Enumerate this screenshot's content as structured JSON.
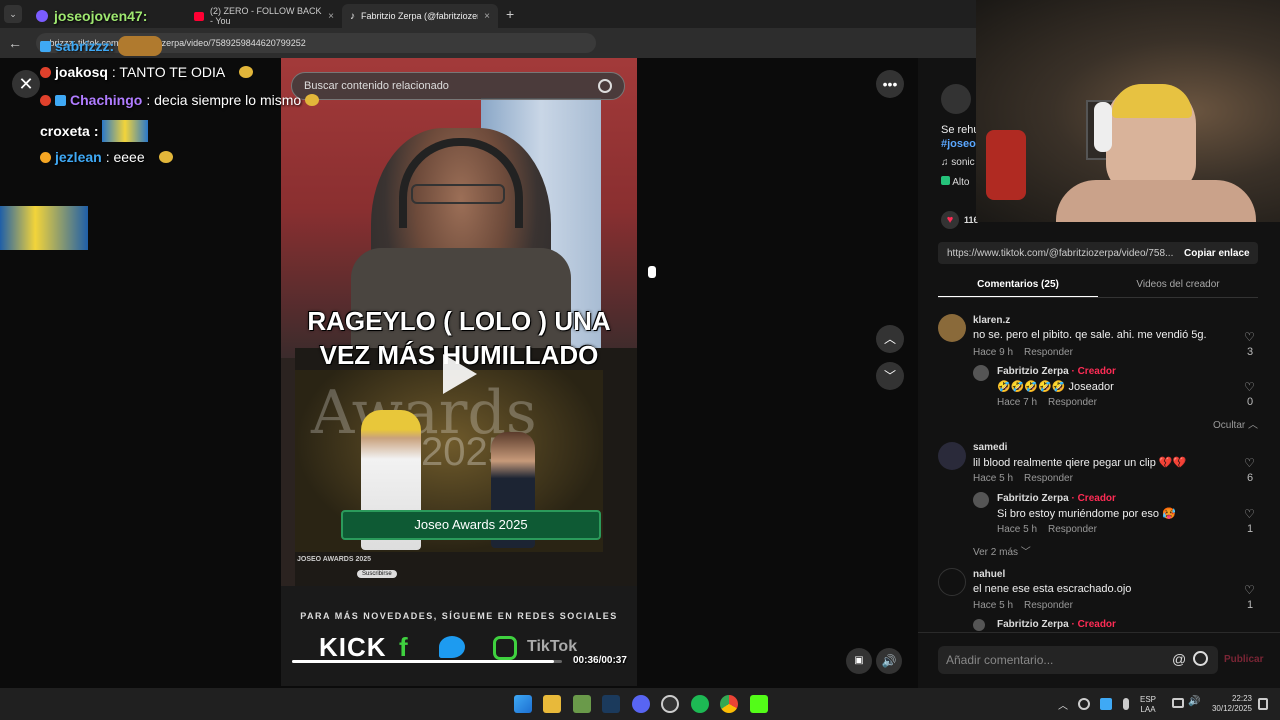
{
  "browser": {
    "tabs": [
      {
        "label": "joseojoven47:",
        "close": "×"
      },
      {
        "label": "(2) ZERO - FOLLOW BACK - You",
        "close": "×"
      },
      {
        "label": "Fabritzio Zerpa (@fabritziozerp",
        "close": "×"
      }
    ],
    "new_tab": "+",
    "url": "sabrizzz: tiktok.com/@fabritziozerpa/video/7589259844620799252"
  },
  "chat": {
    "header_user": "joseojoven47:",
    "header_user2": "sabrizzz:",
    "lines": [
      {
        "user": "joakosq",
        "text": ": TANTO TE ODIA",
        "color": "#ffffff",
        "badge": "#e0412c"
      },
      {
        "user": "Chachingo",
        "text": ": decia siempre lo mismo",
        "color": "#b07cff",
        "badge": "#e0412c"
      },
      {
        "user": "croxeta",
        "text": ":",
        "color": "#ffffff",
        "badge": ""
      },
      {
        "user": "jezlean",
        "text": ": eeee",
        "color": "#3fa9f5",
        "badge": "#f5a623"
      }
    ]
  },
  "video": {
    "search_placeholder": "Buscar contenido relacionado",
    "caption_line1": "RAGEYLO ( LOLO ) UNA",
    "caption_line2": "VEZ MÁS HUMILLADO",
    "inner_title": "JOSEO AWARDS 2025",
    "banner": "Joseo Awards 2025",
    "awards_big": "Awards",
    "awards_year": "2025",
    "subscribe": "Suscribirse",
    "social_text": "PARA MÁS NOVEDADES, SÍGUEME EN REDES SOCIALES",
    "kick": "KICK",
    "tiktok": "TikTok",
    "time": "00:36/00:37",
    "progress": 0.97
  },
  "panel": {
    "desc_1": "Se rehu",
    "desc_2": "#joseo",
    "sound": "sonic",
    "quality": "Alto",
    "likes": "116",
    "share_url": "https://www.tiktok.com/@fabritziozerpa/video/758...",
    "copy_link": "Copiar enlace",
    "tab_comments": "Comentarios (25)",
    "tab_creator": "Videos del creador",
    "comments": [
      {
        "user": "klaren.z",
        "text": "no se. pero el pibito. qe sale. ahi. me vendió 5g.",
        "time": "Hace 9 h",
        "reply": "Responder",
        "likes": "3"
      },
      {
        "user": "Fabritzio Zerpa",
        "creator": "· Creador",
        "text": "🤣🤣🤣🤣🤣 Joseador",
        "time": "Hace 7 h",
        "reply": "Responder",
        "likes": "0"
      },
      {
        "user": "samedi",
        "text": "lil blood realmente qiere pegar un clip 💔💔",
        "time": "Hace 5 h",
        "reply": "Responder",
        "likes": "6"
      },
      {
        "user": "Fabritzio Zerpa",
        "creator": "· Creador",
        "text": "Si bro estoy muriéndome por eso 🥵",
        "time": "Hace 5 h",
        "reply": "Responder",
        "likes": "1"
      },
      {
        "user": "nahuel",
        "text": "el nene ese esta escrachado.ojo",
        "time": "Hace 5 h",
        "reply": "Responder",
        "likes": "1"
      },
      {
        "user": "Fabritzio Zerpa",
        "creator": "· Creador",
        "text": "",
        "time": "",
        "reply": "",
        "likes": ""
      }
    ],
    "hide": "Ocultar",
    "more": "Ver 2 más",
    "comment_placeholder": "Añadir comentario...",
    "publish": "Publicar"
  },
  "taskbar": {
    "lang1": "ESP",
    "lang2": "LAA",
    "time": "22:23",
    "date": "30/12/2025"
  }
}
